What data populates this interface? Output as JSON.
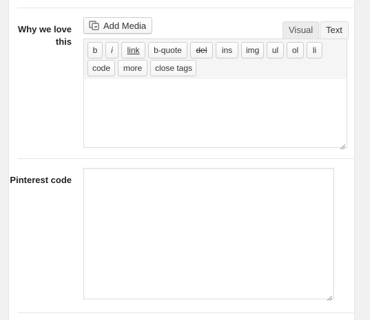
{
  "fields": {
    "why_label": "Why we love this",
    "pinterest_label": "Pinterest code"
  },
  "editor": {
    "add_media_label": "Add Media",
    "tabs": [
      {
        "label": "Visual",
        "active": false
      },
      {
        "label": "Text",
        "active": true
      }
    ],
    "quicktags": [
      "b",
      "i",
      "link",
      "b-quote",
      "del",
      "ins",
      "img",
      "ul",
      "ol",
      "li",
      "code",
      "more",
      "close tags"
    ],
    "content": ""
  },
  "pinterest": {
    "content": ""
  },
  "icons": {
    "add_media": "media-icon",
    "resize": "resize-grip-icon"
  },
  "colors": {
    "background": "#f1f1f1",
    "panel": "#ffffff",
    "border": "#dddddd"
  }
}
